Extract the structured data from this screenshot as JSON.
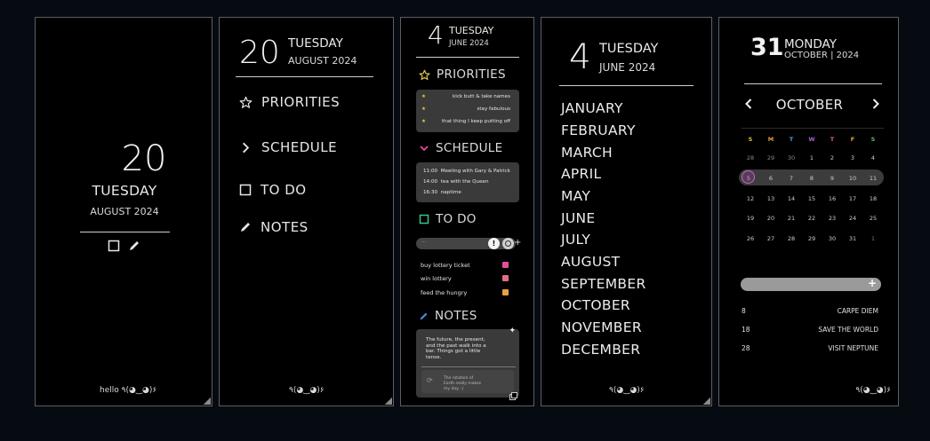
{
  "panel1": {
    "day": "20",
    "weekday": "TUESDAY",
    "month_year": "AUGUST 2024",
    "icons": [
      "checkbox-icon",
      "pencil-icon"
    ],
    "footer": "hello ٩(◕‿◕)۶"
  },
  "panel2": {
    "day": "20",
    "weekday": "TUESDAY",
    "month_year": "AUGUST 2024",
    "menu": [
      {
        "label": "PRIORITIES",
        "icon": "star-icon"
      },
      {
        "label": "SCHEDULE",
        "icon": "chevron-right-icon"
      },
      {
        "label": "TO DO",
        "icon": "checkbox-icon"
      },
      {
        "label": "NOTES",
        "icon": "pencil-icon"
      }
    ],
    "footer": "٩(◕‿◕)۶"
  },
  "panel3": {
    "day": "4",
    "weekday": "TUESDAY",
    "month_year": "JUNE 2024",
    "priorities_label": "PRIORITIES",
    "priorities": [
      "kick butt & take names",
      "stay fabulous",
      "that thing I keep putting off"
    ],
    "schedule_label": "SCHEDULE",
    "schedule": [
      {
        "time": "11:00",
        "event": "Meeting with Gary & Patrick"
      },
      {
        "time": "14:00",
        "event": "tea with the Queen"
      },
      {
        "time": "16:30",
        "event": "naptime"
      }
    ],
    "todo_label": "TO DO",
    "todo_input_placeholder": "...",
    "todos": [
      {
        "text": "buy lottery ticket",
        "color": "#e0509a"
      },
      {
        "text": "win lottery",
        "color": "#e07080"
      },
      {
        "text": "feed the hungry",
        "color": "#e8a040"
      }
    ],
    "notes_label": "NOTES",
    "note_text": "The future, the present, and the past walk into a bar. Things got a little tense.",
    "note_sub": "The rotation of Earth really makes my day. :)",
    "colors": {
      "star": "#e6c84a",
      "schedule_chevron": "#e04a9a",
      "todo_box": "#3fbf8a",
      "notes_pencil": "#4a8ae0"
    }
  },
  "panel4": {
    "day": "4",
    "weekday": "TUESDAY",
    "month_year": "JUNE 2024",
    "months": [
      "JANUARY",
      "FEBRUARY",
      "MARCH",
      "APRIL",
      "MAY",
      "JUNE",
      "JULY",
      "AUGUST",
      "SEPTEMBER",
      "OCTOBER",
      "NOVEMBER",
      "DECEMBER"
    ],
    "footer": "٩(◕‿◕)۶"
  },
  "panel5": {
    "day": "31",
    "weekday": "MONDAY",
    "month_year": "OCTOBER | 2024",
    "cal_month": "OCTOBER",
    "weekdays": [
      {
        "label": "S",
        "color": "#d8c040"
      },
      {
        "label": "M",
        "color": "#e0a040"
      },
      {
        "label": "T",
        "color": "#4aa0e0"
      },
      {
        "label": "W",
        "color": "#b060d0"
      },
      {
        "label": "T",
        "color": "#e05a9a"
      },
      {
        "label": "F",
        "color": "#e0a040"
      },
      {
        "label": "S",
        "color": "#50c070"
      }
    ],
    "weeks": [
      [
        "28",
        "29",
        "30",
        "1",
        "2",
        "3",
        "4"
      ],
      [
        "5",
        "6",
        "7",
        "8",
        "9",
        "10",
        "11"
      ],
      [
        "12",
        "13",
        "14",
        "15",
        "16",
        "17",
        "18"
      ],
      [
        "19",
        "20",
        "21",
        "22",
        "23",
        "24",
        "25"
      ],
      [
        "26",
        "27",
        "28",
        "29",
        "30",
        "31",
        "1"
      ]
    ],
    "events": [
      {
        "day": "8",
        "title": "CARPE DIEM"
      },
      {
        "day": "18",
        "title": "SAVE THE WORLD"
      },
      {
        "day": "28",
        "title": "VISIT NEPTUNE"
      }
    ],
    "footer": "٩(◕‿◕)۶"
  }
}
